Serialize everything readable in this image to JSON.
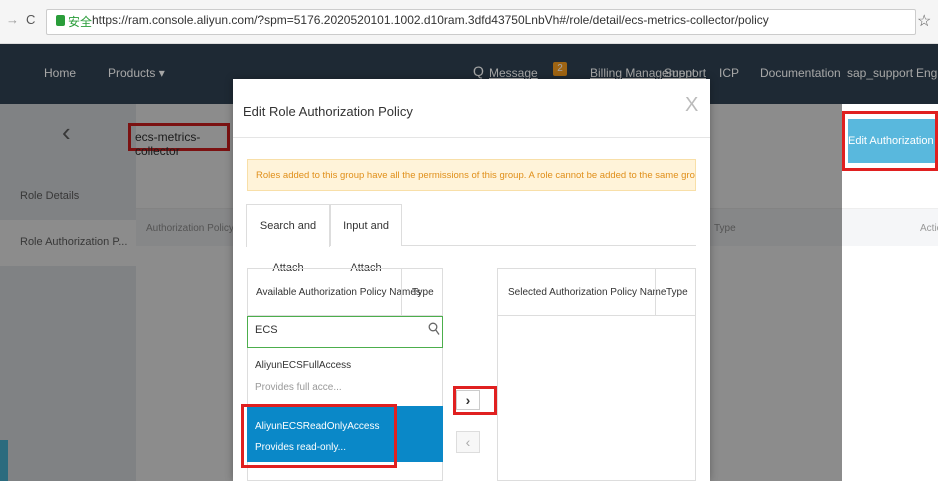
{
  "browser": {
    "back": "→",
    "reload": "C",
    "secure": "安全",
    "url": "https://ram.console.aliyun.com/?spm=5176.2020520101.1002.d10ram.3dfd43750LnbVh#/role/detail/ecs-metrics-collector/policy"
  },
  "topnav": {
    "home": "Home",
    "products": "Products ▾",
    "message": "Message",
    "message_count": "2",
    "billing": "Billing Management",
    "support": "Support",
    "icp": "ICP",
    "documentation": "Documentation",
    "user": "sap_support",
    "lang": "Engl"
  },
  "sidebar": {
    "items": [
      {
        "label": "Role Details"
      },
      {
        "label": "Role Authorization P..."
      }
    ]
  },
  "main": {
    "role_name": "ecs-metrics-collector",
    "edit_button": "Edit Authorization Policy",
    "columns": {
      "name": "Authorization Policy Name",
      "type": "Type",
      "action": "Actio"
    }
  },
  "modal": {
    "title": "Edit Role Authorization Policy",
    "close": "X",
    "notice": "Roles added to this group have all the permissions of this group. A role cannot be added to the same group more than once.",
    "tabs": [
      {
        "label": "Search and Attach"
      },
      {
        "label": "Input and Attach"
      }
    ],
    "left": {
      "header_name": "Available Authorization Policy Names",
      "header_type": "Type",
      "search_value": "ECS",
      "items": [
        {
          "name": "AliyunECSFullAccess",
          "desc": "Provides full acce..."
        },
        {
          "name": "AliyunECSReadOnlyAccess",
          "desc": "Provides read-only..."
        }
      ]
    },
    "right": {
      "header_name": "Selected Authorization Policy Name",
      "header_type": "Type"
    },
    "add_arrow": "›",
    "remove_arrow": "‹"
  },
  "colors": {
    "nav_bg": "#2f4050",
    "selected_bg": "#0a88c8",
    "highlight": "#e02020",
    "notice_bg": "#fff3d9"
  }
}
